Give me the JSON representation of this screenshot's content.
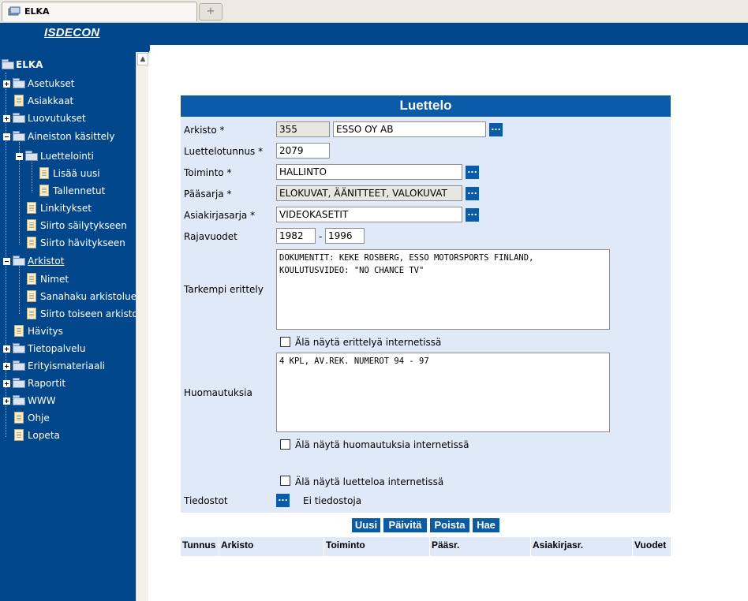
{
  "browser": {
    "tab_title": "ELKA",
    "new_tab": "+"
  },
  "header": {
    "logo": "ISDECON"
  },
  "sidebar": {
    "root": "ELKA",
    "items": [
      {
        "label": "Asetukset"
      },
      {
        "label": "Asiakkaat"
      },
      {
        "label": "Luovutukset"
      },
      {
        "label": "Aineiston käsittely"
      },
      {
        "label": "Luettelointi"
      },
      {
        "label": "Lisää uusi"
      },
      {
        "label": "Tallennetut"
      },
      {
        "label": "Linkitykset"
      },
      {
        "label": "Siirto säilytykseen"
      },
      {
        "label": "Siirto hävitykseen"
      },
      {
        "label": "Arkistot"
      },
      {
        "label": "Nimet"
      },
      {
        "label": "Sanahaku arkistoluettelo"
      },
      {
        "label": "Siirto toiseen arkistoon"
      },
      {
        "label": "Hävitys"
      },
      {
        "label": "Tietopalvelu"
      },
      {
        "label": "Erityismateriaali"
      },
      {
        "label": "Raportit"
      },
      {
        "label": "WWW"
      },
      {
        "label": "Ohje"
      },
      {
        "label": "Lopeta"
      }
    ]
  },
  "form": {
    "title": "Luettelo",
    "arkisto": {
      "label": "Arkisto *",
      "code": "355",
      "name": "ESSO OY AB"
    },
    "luettelotunnus": {
      "label": "Luettelotunnus *",
      "value": "2079"
    },
    "toiminto": {
      "label": "Toiminto *",
      "value": "HALLINTO"
    },
    "paasarja": {
      "label": "Pääsarja *",
      "value": "ELOKUVAT, ÄÄNITTEET, VALOKUVAT"
    },
    "asiakirjasarja": {
      "label": "Asiakirjasarja *",
      "value": "VIDEOKASETIT"
    },
    "rajavuodet": {
      "label": "Rajavuodet",
      "from": "1982",
      "sep": "-",
      "to": "1996"
    },
    "tarkempi": {
      "label": "Tarkempi erittely",
      "value": "DOKUMENTIT: KEKE ROSBERG, ESSO MOTORSPORTS FINLAND,\nKOULUTUSVIDEO: \"NO CHANCE TV\""
    },
    "chk_erittely": "Älä näytä erittelyä internetissä",
    "huomautuksia": {
      "label": "Huomautuksia",
      "value": "4 KPL, AV.REK. NUMEROT 94 - 97"
    },
    "chk_huom": "Älä näytä huomautuksia internetissä",
    "chk_luettelo": "Älä näytä luetteloa internetissä",
    "tiedostot": {
      "label": "Tiedostot",
      "value": "Ei tiedostoja"
    },
    "dots": "..."
  },
  "buttons": {
    "uusi": "Uusi",
    "paivita": "Päivitä",
    "poista": "Poista",
    "hae": "Hae"
  },
  "table": {
    "headers": [
      "Tunnus",
      "Arkisto",
      "Toiminto",
      "Pääsr.",
      "Asiakirjasr.",
      "Vuodet"
    ]
  },
  "colors": {
    "nav_blue": "#02478c",
    "title_blue": "#0a5ba8",
    "panel_bg": "#dfe9f7"
  }
}
